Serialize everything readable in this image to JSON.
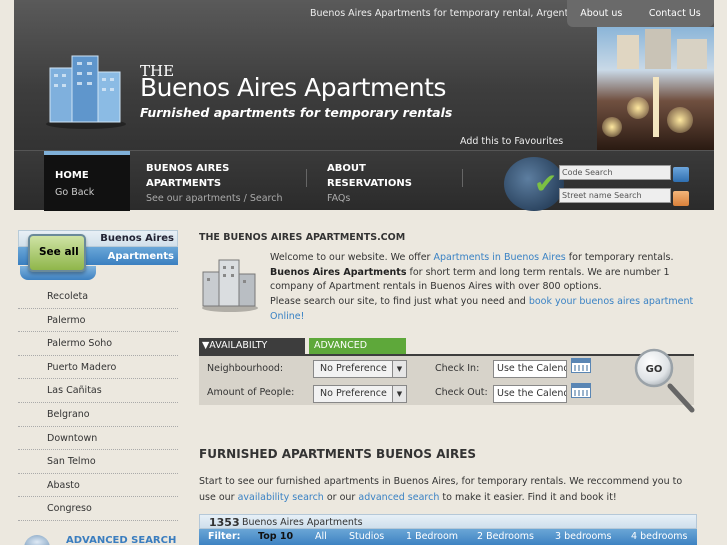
{
  "header": {
    "tagline": "Buenos Aires Apartments for temporary rental, Argentina",
    "about_label": "About us",
    "contact_label": "Contact Us",
    "logo_the": "THE",
    "logo_title": "Buenos Aires Apartments",
    "logo_sub": "Furnished apartments for temporary rentals",
    "favourites_label": "Add this to Favourites"
  },
  "nav": {
    "home_label": "HOME",
    "home_sub": "Go Back",
    "apartments_line1": "BUENOS AIRES",
    "apartments_line2": "APARTMENTS",
    "apartments_sub": "See our apartments / Search",
    "about_line1": "ABOUT",
    "about_line2": "RESERVATIONS",
    "about_sub": "FAQs",
    "code_search_placeholder": "Code Search",
    "street_search_placeholder": "Street name Search"
  },
  "sidebar": {
    "seeall_button": "See all",
    "seeall_label1": "Buenos Aires",
    "seeall_label2": "Apartments",
    "neighbourhoods": [
      "Recoleta",
      "Palermo",
      "Palermo Soho",
      "Puerto Madero",
      "Las Cañitas",
      "Belgrano",
      "Downtown",
      "San Telmo",
      "Abasto",
      "Congreso"
    ],
    "advanced_search_label": "ADVANCED SEARCH"
  },
  "main": {
    "title": "THE BUENOS AIRES APARTMENTS.COM",
    "intro_1": "Welcome to our website. We offer ",
    "intro_link1": "Apartments in Buenos Aires",
    "intro_2": " for temporary rentals. ",
    "intro_bold": "Buenos Aires Apartments",
    "intro_3": " for short term and long term rentals. We are number 1 company of Apartment rentals in Buenos Aires with over 800 options.",
    "intro_4": "Please search our site, to find just what you need and ",
    "intro_link2": "book your buenos aires apartment Online!",
    "tab_availability": "▼AVAILABILTY SEARCH",
    "tab_advanced": "ADVANCED SEARCH",
    "neighbourhood_label": "Neighbourhood:",
    "neighbourhood_value": "No Preference",
    "people_label": "Amount of People:",
    "people_value": "No Preference",
    "checkin_label": "Check In:",
    "checkin_value": "Use the Calendar",
    "checkout_label": "Check Out:",
    "checkout_value": "Use the Calendar",
    "go_label": "GO",
    "furnished_title": "FURNISHED APARTMENTS BUENOS AIRES",
    "furnished_1": "Start to see our furnished apartments in Buenos Aires, for temporary rentals. We reccommend you to use our ",
    "furnished_link1": "availability search",
    "furnished_2": " or our ",
    "furnished_link2": "advanced search",
    "furnished_3": " to make it easier. Find it and book it!",
    "results_count": "1353",
    "results_label": "Buenos Aires Apartments",
    "filters": [
      "Filter:",
      "Top 10",
      "All",
      "Studios",
      "1 Bedroom",
      "2 Bedrooms",
      "3 bedrooms",
      "4 bedrooms"
    ]
  },
  "colors": {
    "accent_blue": "#3a82c4",
    "accent_green": "#5ea83a",
    "header_dark": "#3d3d3d",
    "background": "#ece8df"
  }
}
